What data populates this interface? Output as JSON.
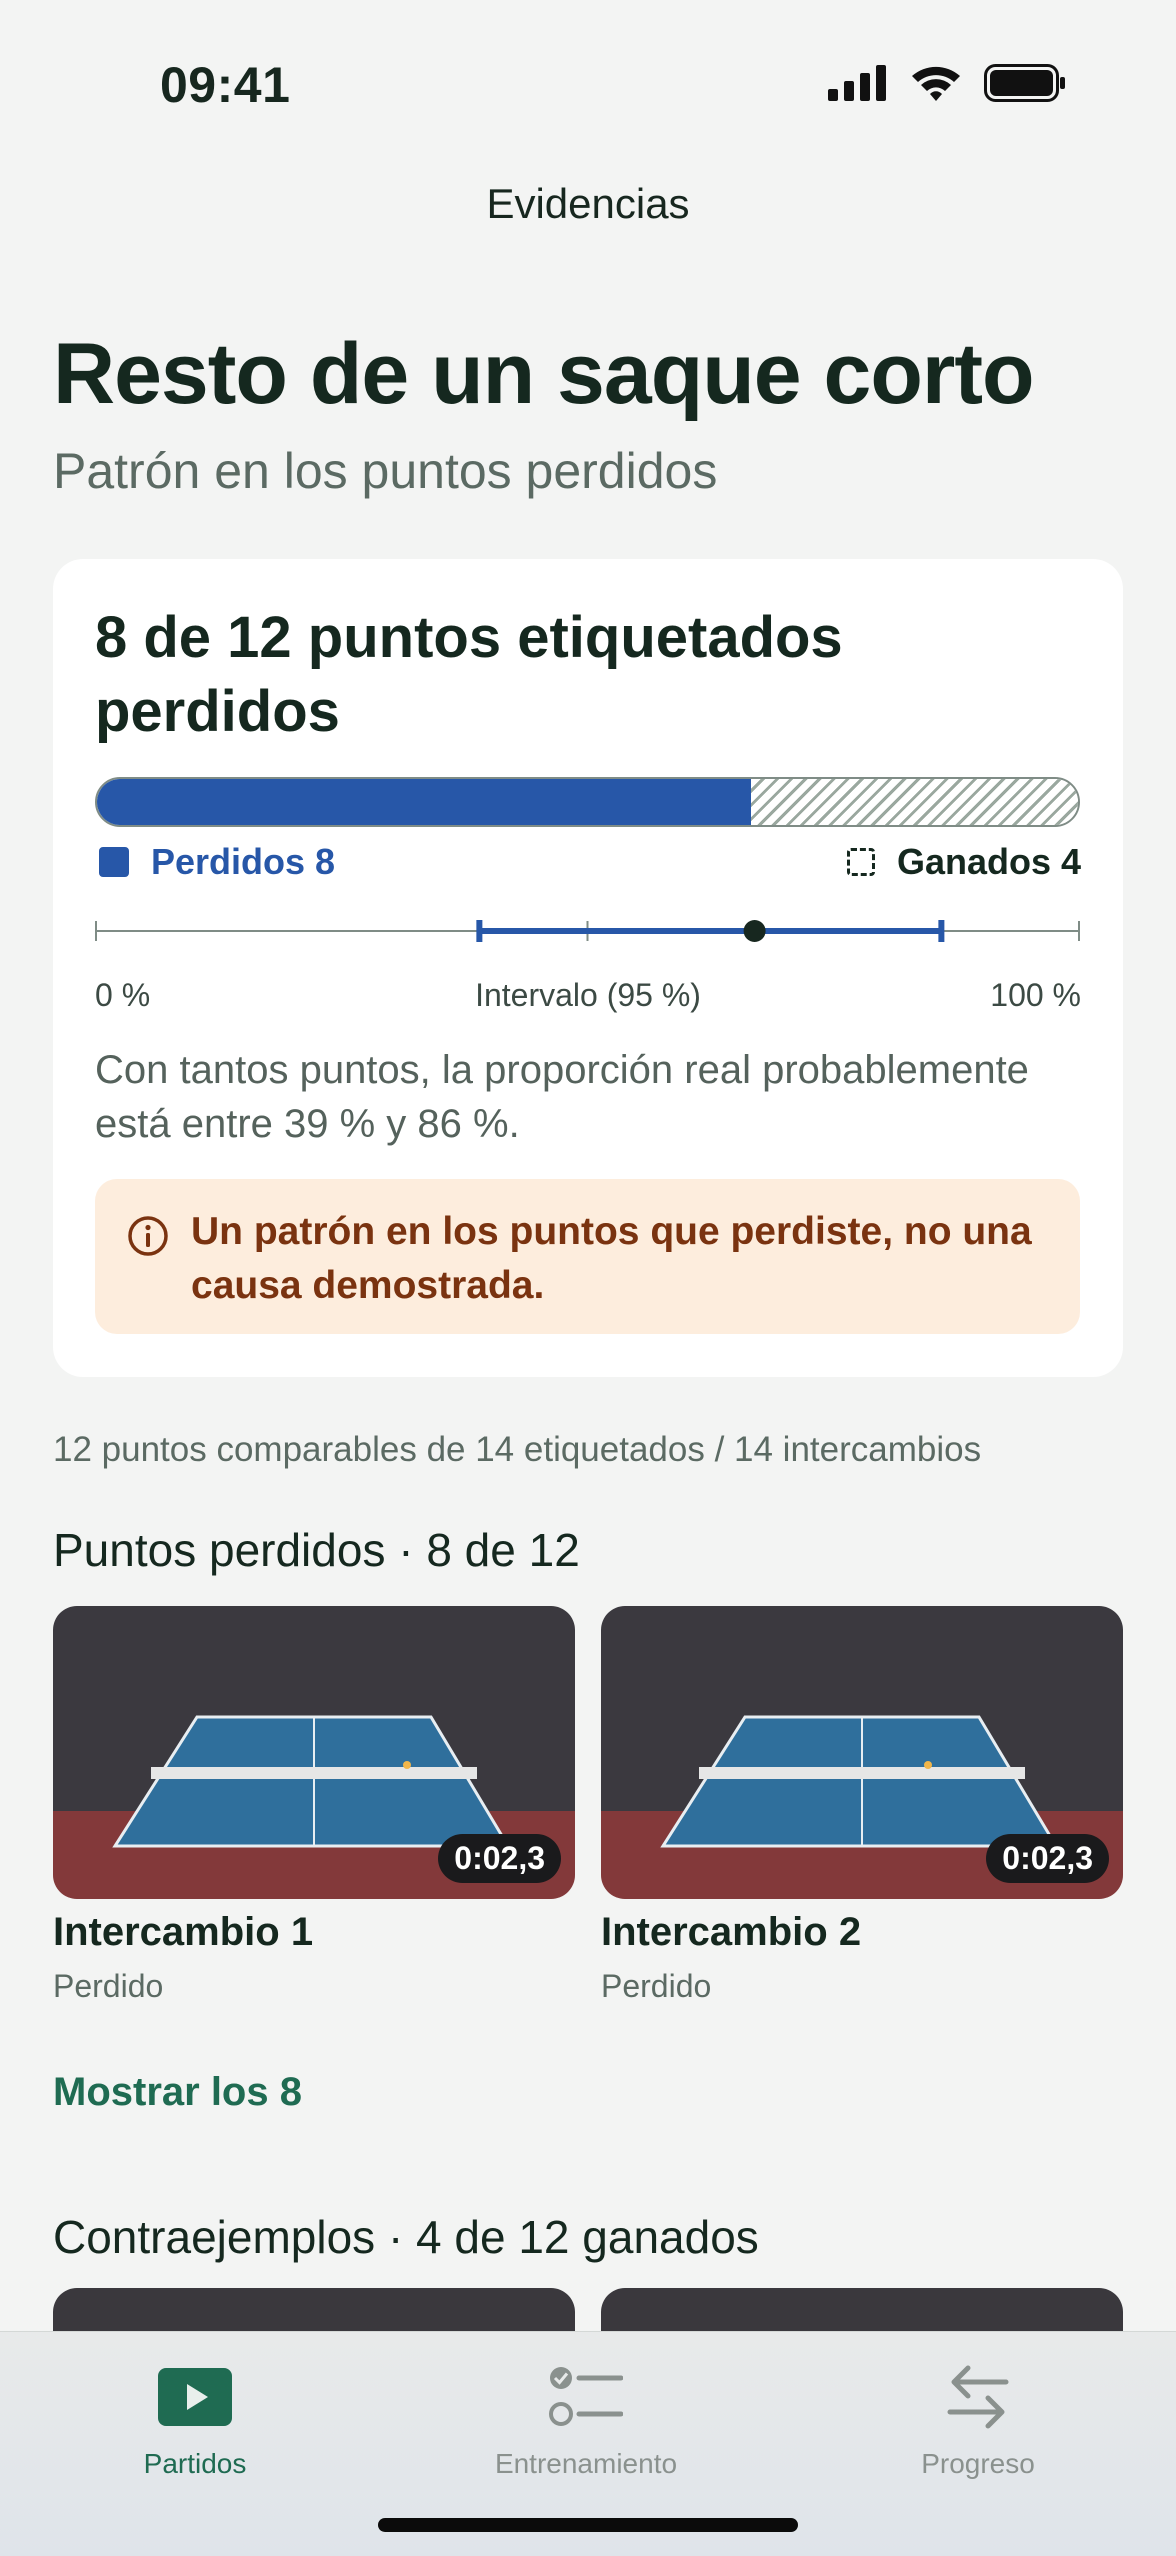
{
  "status_bar": {
    "time": "09:41",
    "icons": [
      "signal-icon",
      "wifi-icon",
      "battery-icon"
    ]
  },
  "nav": {
    "title": "Evidencias"
  },
  "header": {
    "title": "Resto de un saque corto",
    "subtitle": "Patrón en los puntos perdidos"
  },
  "summary": {
    "headline": "8 de 12 puntos etiquetados perdidos",
    "lost_count": 8,
    "won_count": 4,
    "total": 12,
    "lost_fraction": 0.667,
    "legend_lost": "Perdidos 8",
    "legend_won": "Ganados 4",
    "interval": {
      "low_percent": 39,
      "high_percent": 86,
      "estimate_percent": 67
    },
    "axis_start": "0 %",
    "axis_mid": "Intervalo (95 %)",
    "axis_end": "100 %",
    "interval_text": "Con tantos puntos, la proporción real probablemente está entre 39 % y 86 %.",
    "warning": "Un patrón en los puntos que perdiste, no una causa demostrada."
  },
  "meta_line": "12 puntos comparables de 14 etiquetados / 14 intercambios",
  "lost_section": {
    "title": "Puntos perdidos · 8 de 12",
    "items": [
      {
        "title": "Intercambio 1",
        "status": "Perdido",
        "duration": "0:02,3"
      },
      {
        "title": "Intercambio 2",
        "status": "Perdido",
        "duration": "0:02,3"
      }
    ],
    "show_more": "Mostrar los 8"
  },
  "counter_section": {
    "title": "Contraejemplos · 4 de 12 ganados"
  },
  "tabbar": {
    "tabs": [
      {
        "label": "Partidos",
        "icon": "play-icon",
        "active": true
      },
      {
        "label": "Entrenamiento",
        "icon": "checklist-icon",
        "active": false
      },
      {
        "label": "Progreso",
        "icon": "arrows-swap-icon",
        "active": false
      }
    ]
  },
  "colors": {
    "accent": "#1f6b52",
    "lost": "#2757a8",
    "warning_bg": "#fdeddd",
    "warning_text": "#7a3310"
  }
}
